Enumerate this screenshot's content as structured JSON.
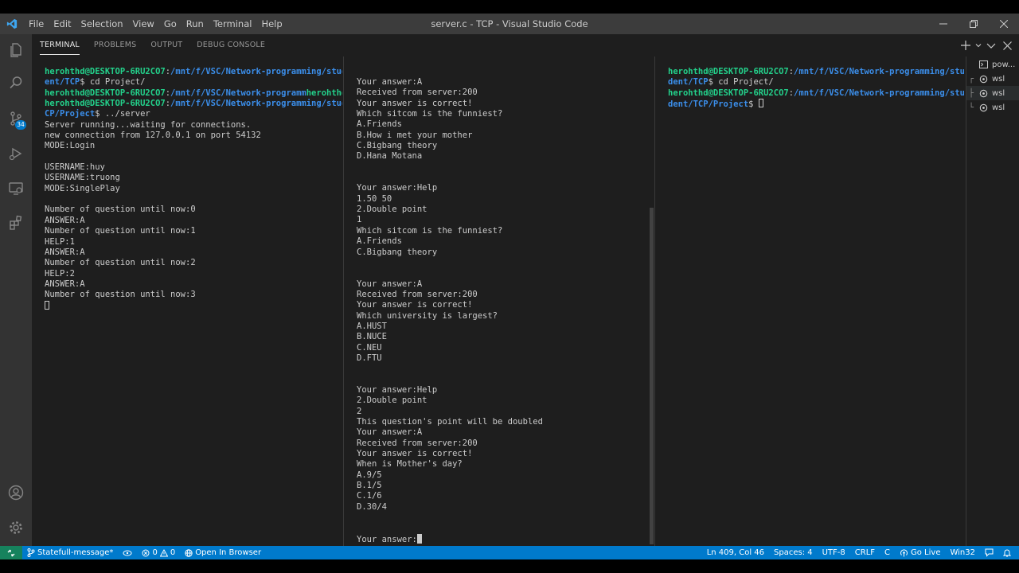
{
  "window": {
    "title": "server.c - TCP - Visual Studio Code",
    "menu": [
      "File",
      "Edit",
      "Selection",
      "View",
      "Go",
      "Run",
      "Terminal",
      "Help"
    ]
  },
  "activity_bar": {
    "icons": [
      "files-icon",
      "search-icon",
      "source-control-icon",
      "run-debug-icon",
      "remote-explorer-icon",
      "extensions-icon",
      "account-icon",
      "settings-gear-icon"
    ],
    "source_control_badge": "34"
  },
  "panel": {
    "tabs": [
      {
        "label": "TERMINAL",
        "active": true
      },
      {
        "label": "PROBLEMS",
        "active": false
      },
      {
        "label": "OUTPUT",
        "active": false
      },
      {
        "label": "DEBUG CONSOLE",
        "active": false
      }
    ]
  },
  "terminal_list": [
    {
      "label": "pow..."
    },
    {
      "label": "wsl"
    },
    {
      "label": "wsl"
    },
    {
      "label": "wsl"
    }
  ],
  "terminals": [
    {
      "lines": [
        [
          {
            "t": "herohthd@DESKTOP-6RU2CO7",
            "c": "pu"
          },
          {
            "t": ":"
          },
          {
            "t": "/mnt/f/VSC/Network-programming/stud",
            "c": "pp"
          }
        ],
        [
          {
            "t": "ent/TCP",
            "c": "pp"
          },
          {
            "t": "$ cd Project/"
          }
        ],
        [
          {
            "t": "herohthd@DESKTOP-6RU2CO7",
            "c": "pu"
          },
          {
            "t": ":"
          },
          {
            "t": "/mnt/f/VSC/Network-programm",
            "c": "pp"
          },
          {
            "t": "herohthd",
            "c": "pu"
          }
        ],
        [
          {
            "t": "herohthd@DESKTOP-6RU2CO7",
            "c": "pu"
          },
          {
            "t": ":"
          },
          {
            "t": "/mnt/f/VSC/Network-programming/stud",
            "c": "pp"
          }
        ],
        [
          {
            "t": "CP/Project",
            "c": "pp"
          },
          {
            "t": "$ ../server"
          }
        ],
        [
          {
            "t": "Server running...waiting for connections."
          }
        ],
        [
          {
            "t": "new connection from 127.0.0.1 on port 54132"
          }
        ],
        [
          {
            "t": "MODE:Login"
          }
        ],
        [],
        [
          {
            "t": "USERNAME:huy"
          }
        ],
        [
          {
            "t": "USERNAME:truong"
          }
        ],
        [
          {
            "t": "MODE:SinglePlay"
          }
        ],
        [],
        [
          {
            "t": "Number of question until now:0"
          }
        ],
        [
          {
            "t": "ANSWER:A"
          }
        ],
        [
          {
            "t": "Number of question until now:1"
          }
        ],
        [
          {
            "t": "HELP:1"
          }
        ],
        [
          {
            "t": "ANSWER:A"
          }
        ],
        [
          {
            "t": "Number of question until now:2"
          }
        ],
        [
          {
            "t": "HELP:2"
          }
        ],
        [
          {
            "t": "ANSWER:A"
          }
        ],
        [
          {
            "t": "Number of question until now:3"
          }
        ],
        [
          {
            "cursor": "block"
          }
        ]
      ]
    },
    {
      "lines": [
        [
          {
            "t": "Your answer:A"
          }
        ],
        [
          {
            "t": "Received from server:200"
          }
        ],
        [
          {
            "t": "Your answer is correct!"
          }
        ],
        [
          {
            "t": "Which sitcom is the funniest?"
          }
        ],
        [
          {
            "t": "A.Friends"
          }
        ],
        [
          {
            "t": "B.How i met your mother"
          }
        ],
        [
          {
            "t": "C.Bigbang theory"
          }
        ],
        [
          {
            "t": "D.Hana Motana"
          }
        ],
        [],
        [],
        [
          {
            "t": "Your answer:Help"
          }
        ],
        [
          {
            "t": "1.50 50"
          }
        ],
        [
          {
            "t": "2.Double point"
          }
        ],
        [
          {
            "t": "1"
          }
        ],
        [
          {
            "t": "Which sitcom is the funniest?"
          }
        ],
        [
          {
            "t": "A.Friends"
          }
        ],
        [
          {
            "t": "C.Bigbang theory"
          }
        ],
        [],
        [],
        [
          {
            "t": "Your answer:A"
          }
        ],
        [
          {
            "t": "Received from server:200"
          }
        ],
        [
          {
            "t": "Your answer is correct!"
          }
        ],
        [
          {
            "t": "Which university is largest?"
          }
        ],
        [
          {
            "t": "A.HUST"
          }
        ],
        [
          {
            "t": "B.NUCE"
          }
        ],
        [
          {
            "t": "C.NEU"
          }
        ],
        [
          {
            "t": "D.FTU"
          }
        ],
        [],
        [],
        [
          {
            "t": "Your answer:Help"
          }
        ],
        [
          {
            "t": "2.Double point"
          }
        ],
        [
          {
            "t": "2"
          }
        ],
        [
          {
            "t": "This question's point will be doubled"
          }
        ],
        [
          {
            "t": "Your answer:A"
          }
        ],
        [
          {
            "t": "Received from server:200"
          }
        ],
        [
          {
            "t": "Your answer is correct!"
          }
        ],
        [
          {
            "t": "When is Mother's day?"
          }
        ],
        [
          {
            "t": "A.9/5"
          }
        ],
        [
          {
            "t": "B.1/5"
          }
        ],
        [
          {
            "t": "C.1/6"
          }
        ],
        [
          {
            "t": "D.30/4"
          }
        ],
        [],
        [],
        [
          {
            "t": "Your answer:"
          },
          {
            "cursor": "solid"
          }
        ]
      ]
    },
    {
      "lines": [
        [
          {
            "t": "herohthd@DESKTOP-6RU2CO7",
            "c": "pu"
          },
          {
            "t": ":"
          },
          {
            "t": "/mnt/f/VSC/Network-programming/stu",
            "c": "pp"
          }
        ],
        [
          {
            "t": "dent/TCP",
            "c": "pp"
          },
          {
            "t": "$ cd Project/"
          }
        ],
        [
          {
            "t": "herohthd@DESKTOP-6RU2CO7",
            "c": "pu"
          },
          {
            "t": ":"
          },
          {
            "t": "/mnt/f/VSC/Network-programming/stu",
            "c": "pp"
          }
        ],
        [
          {
            "t": "dent/TCP/Project",
            "c": "pp"
          },
          {
            "t": "$ "
          },
          {
            "cursor": "block"
          }
        ]
      ]
    }
  ],
  "status_bar": {
    "branch": "Statefull-message*",
    "errors": "0",
    "warnings": "0",
    "open_in_browser": "Open In Browser",
    "position": "Ln 409, Col 46",
    "spaces": "Spaces: 4",
    "encoding": "UTF-8",
    "eol": "CRLF",
    "language": "C",
    "go_live": "Go Live",
    "platform": "Win32"
  }
}
